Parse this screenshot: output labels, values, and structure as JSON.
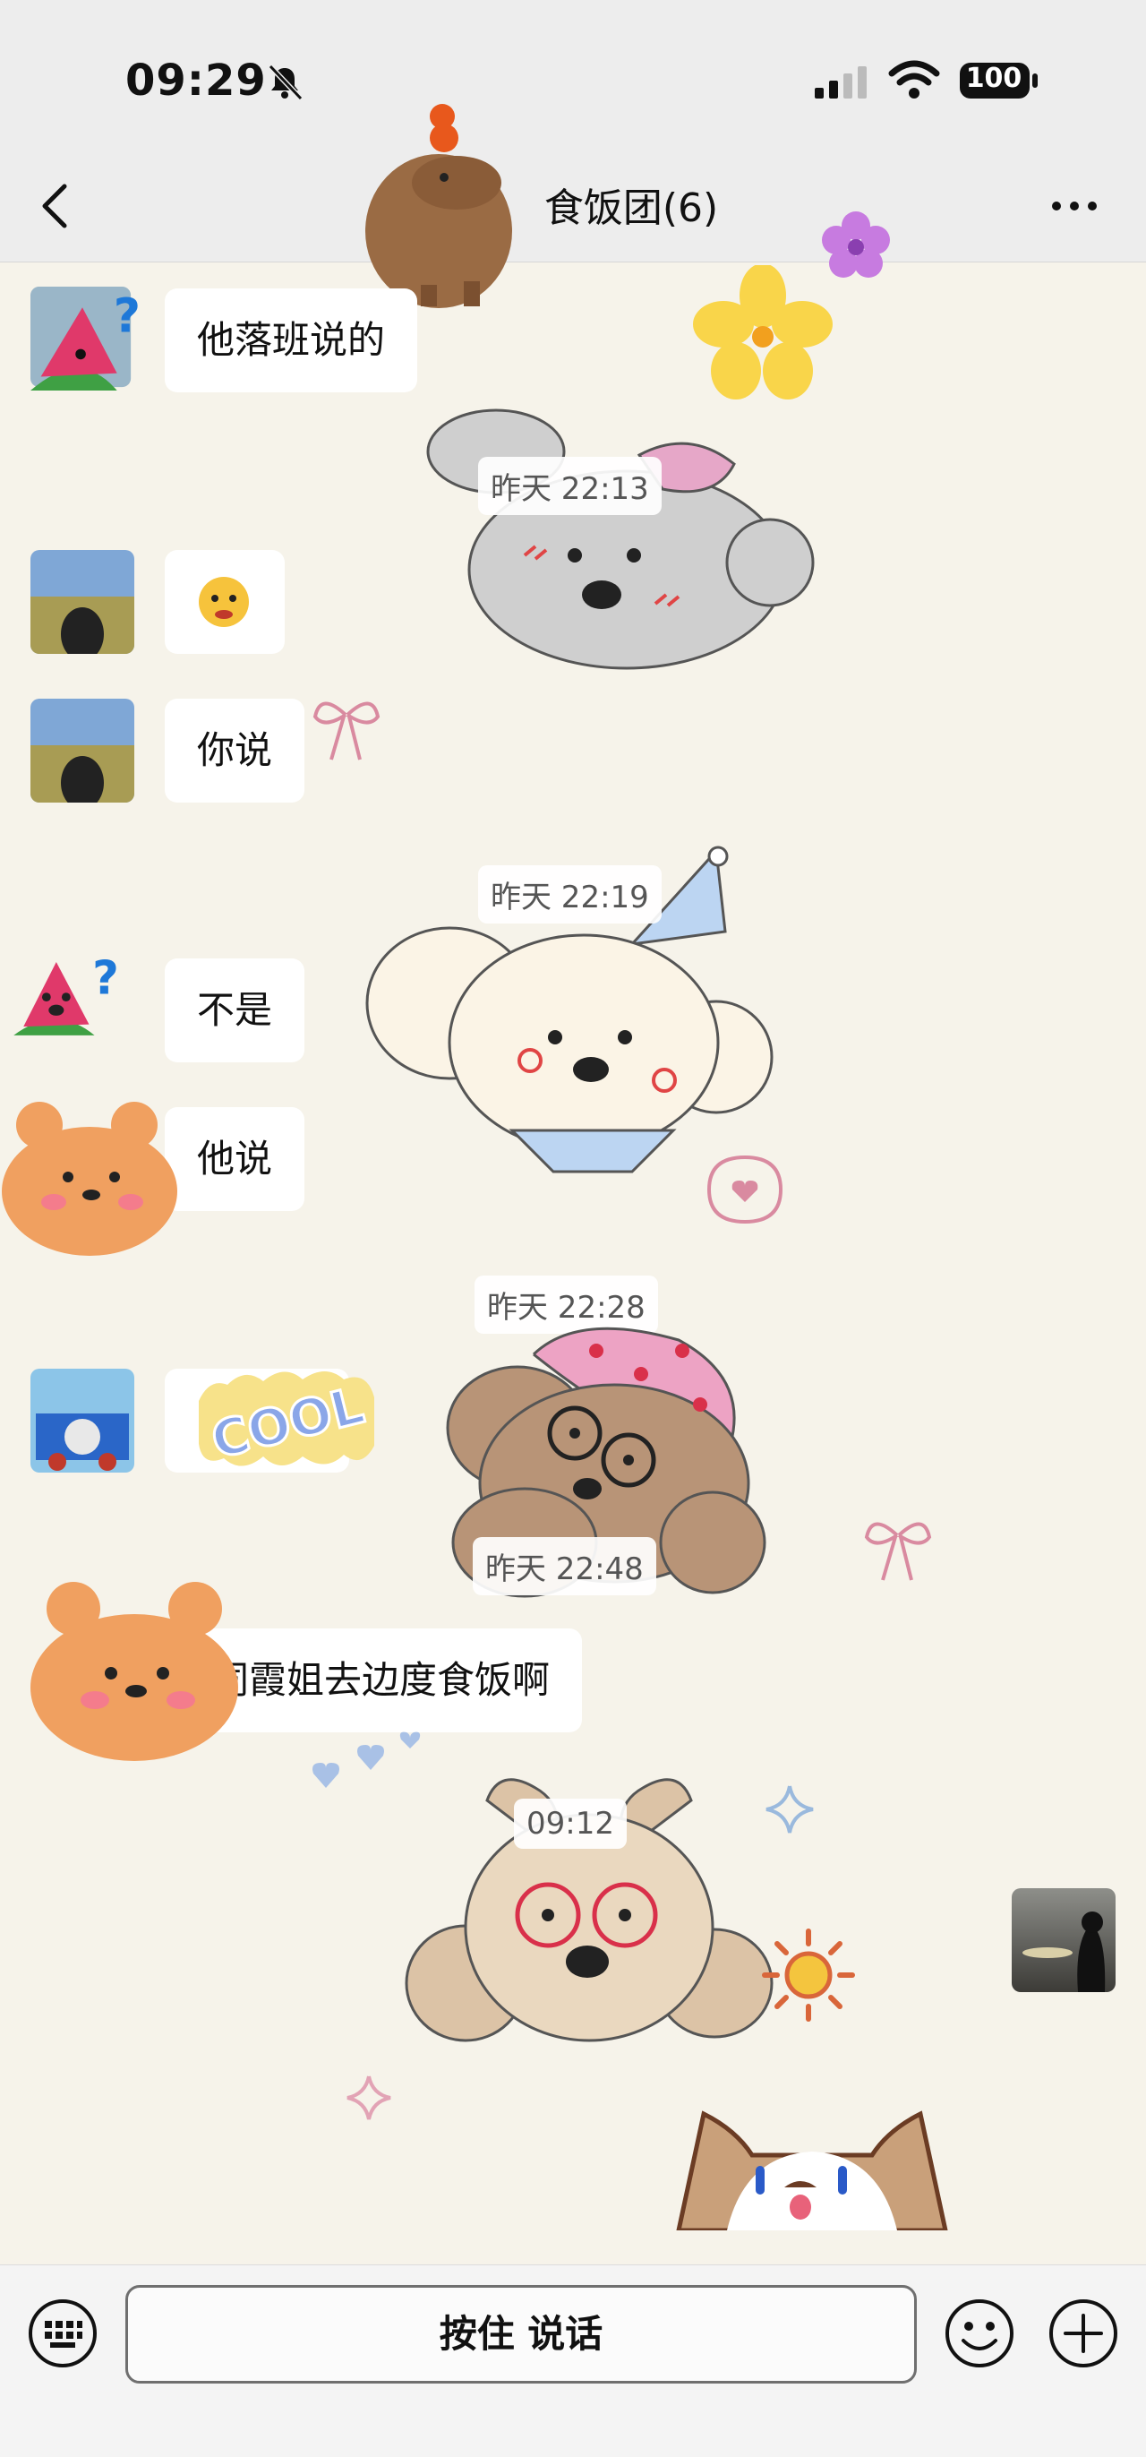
{
  "status_bar": {
    "time": "09:29",
    "battery": "100"
  },
  "nav": {
    "title": "食饭团(6)"
  },
  "messages": [
    {
      "text": "他落班说的"
    },
    {
      "text": ""
    },
    {
      "text": "你说"
    },
    {
      "text": "不是"
    },
    {
      "text": "他说"
    },
    {
      "text": ""
    },
    {
      "text": "同霞姐去边度食饭啊"
    }
  ],
  "timestamps": [
    "昨天 22:13",
    "昨天 22:19",
    "昨天 22:28",
    "昨天 22:48",
    "09:12"
  ],
  "stickers": {
    "cool_text": "COOL"
  },
  "input": {
    "hold_to_talk": "按住 说话"
  },
  "colors": {
    "background": "#f6f3ea",
    "bar": "#ededed",
    "bubble": "#ffffff"
  }
}
